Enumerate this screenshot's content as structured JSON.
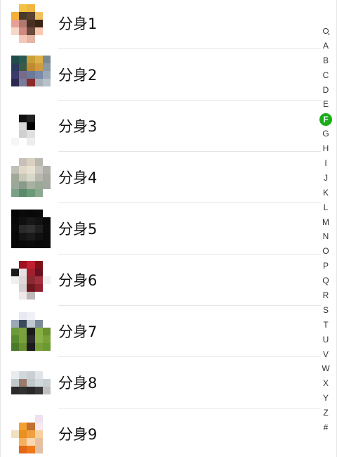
{
  "contacts": [
    {
      "name": "分身1",
      "avatar_colors": [
        "#ffffff",
        "#f4c242",
        "#f0b640",
        "#ffffff",
        "#ffffff",
        "#f1b036",
        "#4a3a2a",
        "#5a4230",
        "#f0c060",
        "#ffffff",
        "#e8a096",
        "#b07a70",
        "#4a3024",
        "#3a2418",
        "#ffffff",
        "#f6d7c8",
        "#d08a80",
        "#6a4a3a",
        "#f8c8b0",
        "#ffffff",
        "#ffffff",
        "#f4c8b8",
        "#e4b4a4",
        "#ffffff",
        "#ffffff"
      ]
    },
    {
      "name": "分身2",
      "avatar_colors": [
        "#1f4e4a",
        "#2a5a50",
        "#c9a03a",
        "#e0b048",
        "#7a8a90",
        "#2a3a5a",
        "#3a5a48",
        "#c08a30",
        "#d09a40",
        "#8a9aa0",
        "#3a3a6a",
        "#7a6a8a",
        "#6a7a9a",
        "#7a8aa8",
        "#9aa8b8",
        "#2a2a50",
        "#7a7a9a",
        "#8a2a2a",
        "#a8b0b8",
        "#b8c0c8",
        "#ffffff",
        "#ffffff",
        "#ffffff",
        "#ffffff",
        "#ffffff"
      ]
    },
    {
      "name": "分身3",
      "avatar_colors": [
        "#ffffff",
        "#ffffff",
        "#ffffff",
        "#ffffff",
        "#ffffff",
        "#ffffff",
        "#111111",
        "#222222",
        "#ffffff",
        "#ffffff",
        "#ffffff",
        "#d8d8d8",
        "#000000",
        "#ffffff",
        "#ffffff",
        "#ffffff",
        "#d0d0d0",
        "#e0e0e0",
        "#ffffff",
        "#ffffff",
        "#f6f6f6",
        "#ffffff",
        "#eeeeee",
        "#ffffff",
        "#ffffff"
      ]
    },
    {
      "name": "分身4",
      "avatar_colors": [
        "#ffffff",
        "#c8c0b8",
        "#d8d0c0",
        "#b8b8b0",
        "#ffffff",
        "#c0c0b8",
        "#e0d8c8",
        "#e8e0d0",
        "#c8c8c0",
        "#b0b0a8",
        "#a0a898",
        "#c8c8b8",
        "#d8d8c8",
        "#b8b8b0",
        "#a8a8a0",
        "#9aa89a",
        "#8a9a88",
        "#a8b0a0",
        "#9aa898",
        "#a0a8a0",
        "#7aa08a",
        "#5a8a6a",
        "#6a9a78",
        "#8aa890",
        "#ffffff"
      ]
    },
    {
      "name": "分身5",
      "avatar_colors": [
        "#050505",
        "#0a0a0a",
        "#080808",
        "#0a0a0a",
        "#ffffff",
        "#080808",
        "#101010",
        "#181818",
        "#121212",
        "#0a0a0a",
        "#0a0a0a",
        "#2a2a2a",
        "#303030",
        "#202020",
        "#0c0c0c",
        "#080808",
        "#141414",
        "#1a1a1a",
        "#101010",
        "#0a0a0a",
        "#060606",
        "#080808",
        "#0a0a0a",
        "#080808",
        "#0a0a0a"
      ]
    },
    {
      "name": "分身6",
      "avatar_colors": [
        "#ffffff",
        "#a01020",
        "#c02030",
        "#801018",
        "#ffffff",
        "#1a1a1a",
        "#e8e0e0",
        "#a02030",
        "#6a1020",
        "#ffffff",
        "#f0f0f0",
        "#e0d8d8",
        "#8a2a30",
        "#a03040",
        "#f0f0f0",
        "#ffffff",
        "#d8d0d0",
        "#701820",
        "#902030",
        "#ffffff",
        "#ffffff",
        "#f0e8e8",
        "#c0b8b8",
        "#ffffff",
        "#ffffff"
      ]
    },
    {
      "name": "分身7",
      "avatar_colors": [
        "#ffffff",
        "#e8e8f0",
        "#f0f0f8",
        "#ffffff",
        "#ffffff",
        "#9aa8b8",
        "#3a4a5a",
        "#c0c8d0",
        "#7a8a9a",
        "#ffffff",
        "#6a9a3a",
        "#7aa040",
        "#1a1a1a",
        "#88b040",
        "#6a9030",
        "#5a8a30",
        "#7aa03a",
        "#2a2a2a",
        "#8ab048",
        "#7aa038",
        "#4a7a28",
        "#6a9030",
        "#1a1a1a",
        "#78a038",
        "#6a9a30"
      ]
    },
    {
      "name": "分身8",
      "avatar_colors": [
        "#ffffff",
        "#ffffff",
        "#ffffff",
        "#ffffff",
        "#ffffff",
        "#e8ecef",
        "#d0d8dc",
        "#c8d0d4",
        "#e0e4e8",
        "#ffffff",
        "#c0c8cc",
        "#9a7a6a",
        "#c0c8cc",
        "#d0d8dc",
        "#c8d0d4",
        "#2a2a2a",
        "#303030",
        "#282828",
        "#383838",
        "#c0c0c0",
        "#ffffff",
        "#ffffff",
        "#ffffff",
        "#ffffff",
        "#ffffff"
      ]
    },
    {
      "name": "分身9",
      "avatar_colors": [
        "#ffffff",
        "#ffffff",
        "#ffffff",
        "#f0e0f0",
        "#ffffff",
        "#ffffff",
        "#f4a030",
        "#c07030",
        "#f8e8f0",
        "#ffffff",
        "#f0e0c0",
        "#e89020",
        "#f0a040",
        "#f8d0a0",
        "#ffffff",
        "#ffffff",
        "#f4b060",
        "#f8d8b0",
        "#e8c0a0",
        "#ffffff",
        "#ffffff",
        "#e06818",
        "#f07818",
        "#e0c0a8",
        "#ffffff"
      ]
    }
  ],
  "index_bar": {
    "search_icon": "search-icon",
    "letters": [
      "A",
      "B",
      "C",
      "D",
      "E",
      "F",
      "G",
      "H",
      "I",
      "J",
      "K",
      "L",
      "M",
      "N",
      "O",
      "P",
      "Q",
      "R",
      "S",
      "T",
      "U",
      "V",
      "W",
      "X",
      "Y",
      "Z",
      "#"
    ],
    "active": "F",
    "active_color": "#1aad19"
  }
}
